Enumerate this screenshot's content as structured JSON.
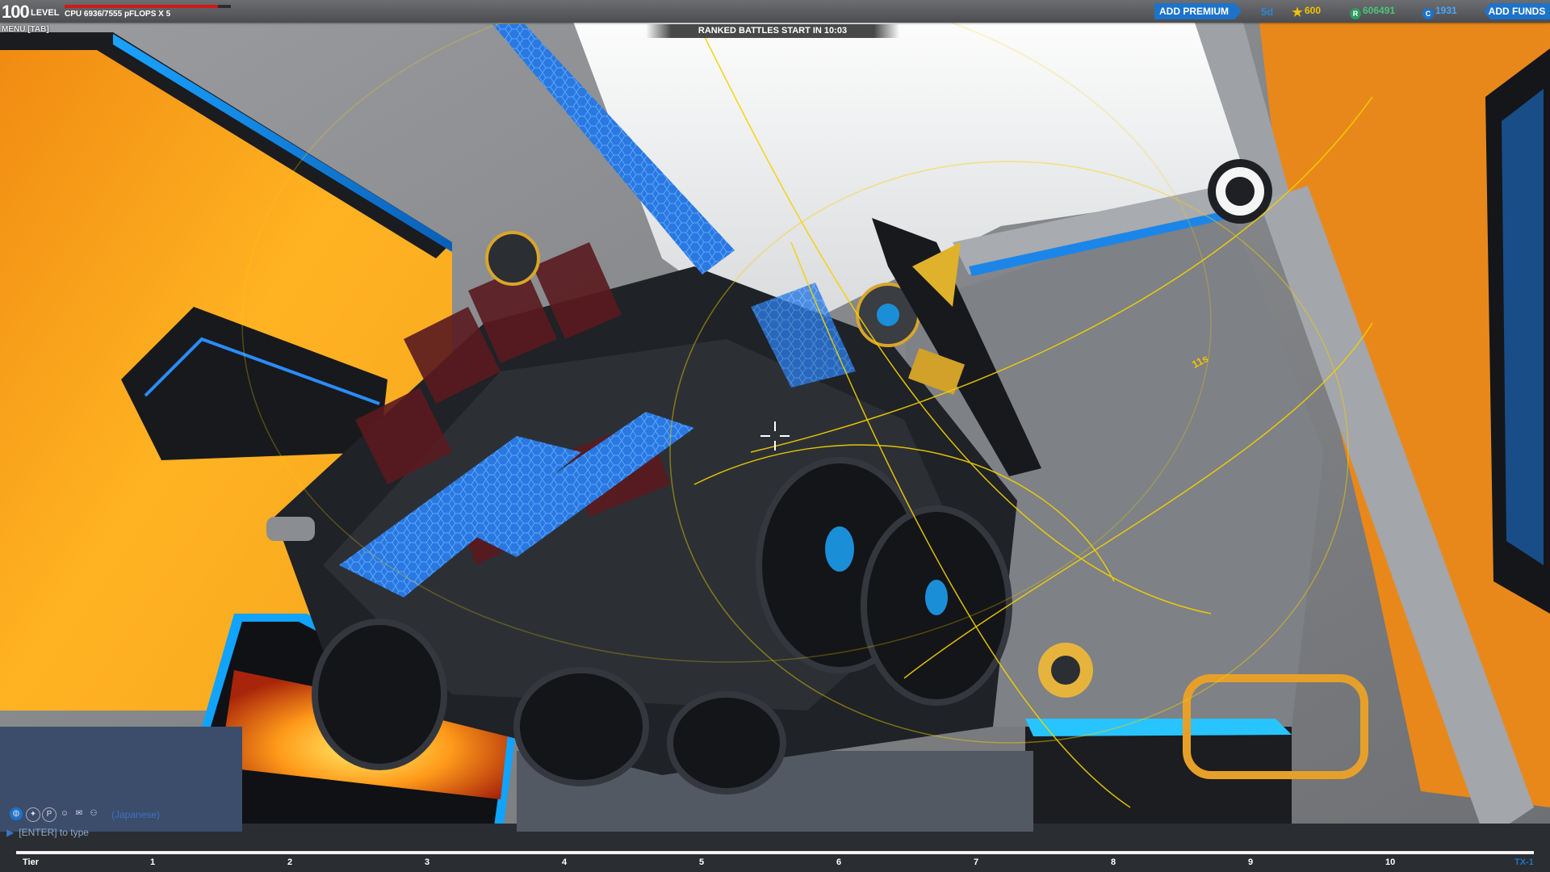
{
  "hud": {
    "level_number": "100",
    "level_label": "LEVEL",
    "cpu_text": "CPU 6936/7555 pFLOPS X 5",
    "cpu_fraction": 0.92,
    "menu_hint": "MENU [TAB]"
  },
  "banner": {
    "ranked_text": "RANKED BATTLES START IN 10:03"
  },
  "topright": {
    "add_premium": "ADD PREMIUM",
    "premium_days": "5d",
    "tech_points": "600",
    "robits": "606491",
    "cosmetic_credits": "1931",
    "add_funds": "ADD FUNDS"
  },
  "chat": {
    "channel": "(Japanese)",
    "prompt": "[ENTER] to type"
  },
  "tier": {
    "label": "Tier",
    "ticks": [
      "1",
      "2",
      "3",
      "4",
      "5",
      "6",
      "7",
      "8",
      "9",
      "10"
    ],
    "current": "TX-1"
  },
  "scene": {
    "distance_readout": "11s"
  },
  "colors": {
    "accent_blue": "#1d73c9",
    "cpu_red": "#d01818",
    "tech_gold": "#f2c200",
    "robits_green": "#4cc47a",
    "cc_blue": "#4aa6ff"
  },
  "icons": [
    "star-icon",
    "robits-icon",
    "cc-icon",
    "crosshair-icon",
    "globe-icon",
    "chat-icon"
  ]
}
